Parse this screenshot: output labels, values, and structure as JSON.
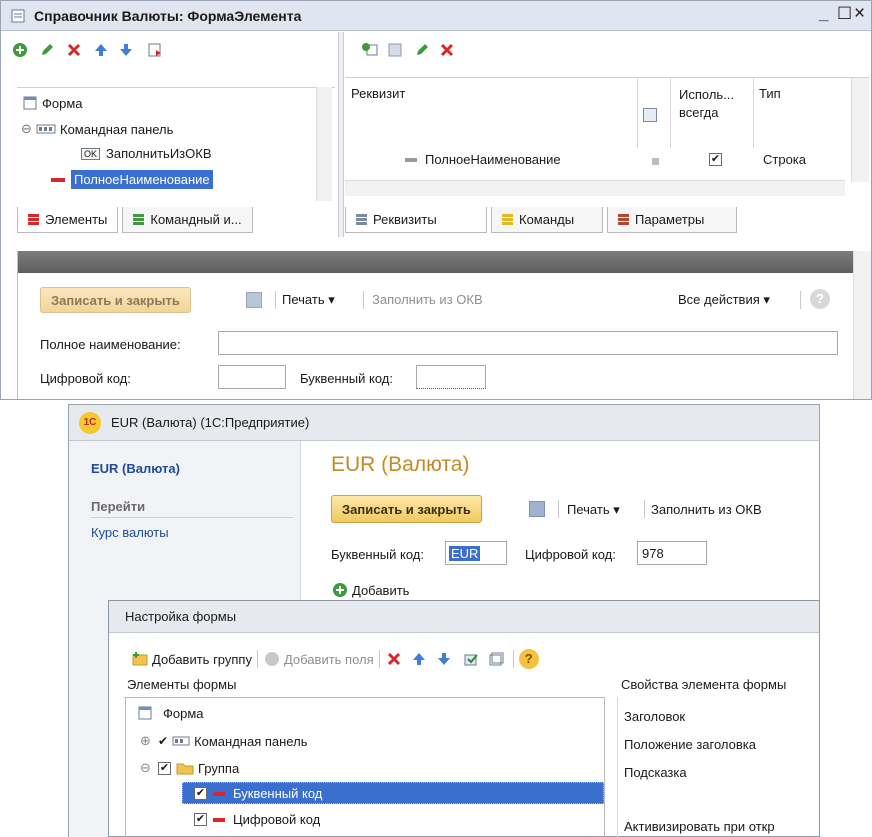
{
  "designer": {
    "title": "Справочник Валюты: ФормаЭлемента",
    "window_controls": [
      "_",
      "☐",
      "×"
    ],
    "tree": [
      {
        "label": "Форма",
        "level": 0,
        "icon": "form-icon"
      },
      {
        "label": "Командная панель",
        "level": 1,
        "icon": "command-panel-icon",
        "expander": "⊖"
      },
      {
        "label": "ЗаполнитьИзОКВ",
        "level": 2,
        "icon": "ok-button-icon",
        "badge": "OK"
      },
      {
        "label": "ПолноеНаименование",
        "level": 1,
        "icon": "field-icon",
        "selected": true
      }
    ],
    "left_tabs": [
      "Элементы",
      "Командный и..."
    ],
    "attr_headers": {
      "name": "Реквизит",
      "use": "Исполь... всегда",
      "type": "Тип"
    },
    "attr_row": {
      "name": "ПолноеНаименование",
      "type": "Строка",
      "checked": "✔"
    },
    "right_tabs": [
      "Реквизиты",
      "Команды",
      "Параметры"
    ]
  },
  "preview": {
    "save_close": "Записать и закрыть",
    "print": "Печать ▾",
    "fill_okv": "Заполнить из ОКВ",
    "all_actions": "Все действия ▾",
    "help": "?",
    "full_name_label": "Полное наименование:",
    "digital_code_label": "Цифровой код:",
    "letter_code_label": "Буквенный код:"
  },
  "enterprise": {
    "title": "EUR (Валюта) (1С:Предприятие)",
    "logo": "1С",
    "nav_title": "EUR (Валюта)",
    "nav_goto": "Перейти",
    "nav_link": "Курс валюты",
    "form_title": "EUR (Валюта)",
    "save_close": "Записать и закрыть",
    "print": "Печать ▾",
    "fill_okv": "Заполнить из ОКВ",
    "letter_code_label": "Буквенный код:",
    "letter_code_value": "EUR",
    "digital_code_label": "Цифровой код:",
    "digital_code_value": "978",
    "add_label": "Добавить"
  },
  "settings": {
    "title": "Настройка формы",
    "add_group": "Добавить группу",
    "add_fields": "Добавить поля",
    "help": "?",
    "elements_label": "Элементы формы",
    "properties_label": "Свойства элемента формы",
    "tree": [
      {
        "label": "Форма"
      },
      {
        "label": "Командная панель",
        "expander": "⊕",
        "check": "✔"
      },
      {
        "label": "Группа",
        "expander": "⊖",
        "check": "✔"
      },
      {
        "label": "Буквенный код",
        "check": "✔",
        "selected": true
      },
      {
        "label": "Цифровой код",
        "check": "✔"
      }
    ],
    "properties": [
      "Заголовок",
      "Положение заголовка",
      "Подсказка",
      "Активизировать при откр"
    ]
  },
  "colors": {
    "title_bar": "#dfe6ef",
    "selection": "#3a6fd0",
    "accent_green": "#3d9b3d",
    "accent_red": "#d9262a",
    "accent_blue": "#3e7ed8",
    "link": "#1f4b9a"
  }
}
